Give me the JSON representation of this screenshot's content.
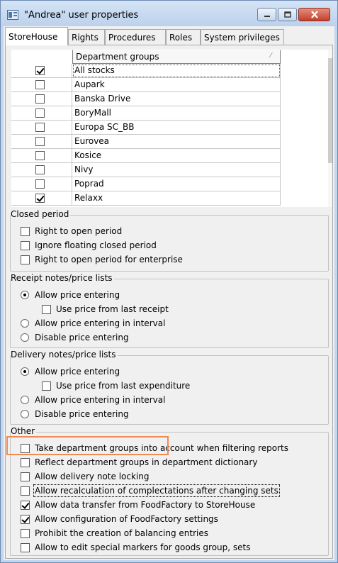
{
  "window": {
    "title": "\"Andrea\" user properties",
    "min_icon": "minimize-icon",
    "max_icon": "maximize-icon",
    "close_icon": "close-icon"
  },
  "tabs": [
    {
      "label": "StoreHouse",
      "active": true
    },
    {
      "label": "Rights",
      "active": false
    },
    {
      "label": "Procedures",
      "active": false
    },
    {
      "label": "Roles",
      "active": false
    },
    {
      "label": "System privileges",
      "active": false
    }
  ],
  "grid": {
    "header": "Department groups",
    "sort_indicator": "⁄",
    "rows": [
      {
        "name": "All stocks",
        "checked": true
      },
      {
        "name": "Aupark",
        "checked": false
      },
      {
        "name": "Banska Drive",
        "checked": false
      },
      {
        "name": "BoryMall",
        "checked": false
      },
      {
        "name": "Europa SC_BB",
        "checked": false
      },
      {
        "name": "Eurovea",
        "checked": false
      },
      {
        "name": "Kosice",
        "checked": false
      },
      {
        "name": "Nivy",
        "checked": false
      },
      {
        "name": "Poprad",
        "checked": false
      },
      {
        "name": "Relaxx",
        "checked": true
      }
    ]
  },
  "closed_period": {
    "label": "Closed period",
    "options": [
      {
        "label": "Right to open period",
        "checked": false
      },
      {
        "label": "Ignore floating closed period",
        "checked": false
      },
      {
        "label": "Right to open period for enterprise",
        "checked": false
      }
    ]
  },
  "receipt": {
    "label": "Receipt notes/price lists",
    "allow": "Allow price entering",
    "use_last": "Use price from last receipt",
    "interval": "Allow price entering in interval",
    "disable": "Disable price entering",
    "selected": "allow"
  },
  "delivery": {
    "label": "Delivery notes/price lists",
    "allow": "Allow price entering",
    "use_last": "Use price from last expenditure",
    "interval": "Allow price entering in interval",
    "disable": "Disable price entering",
    "selected": "allow"
  },
  "other": {
    "label": "Other",
    "options": [
      {
        "label": "Take department groups into account when filtering reports",
        "checked": false
      },
      {
        "label": "Reflect department groups in department dictionary",
        "checked": false
      },
      {
        "label": "Allow delivery note locking",
        "checked": false
      },
      {
        "label": "Allow recalculation of complectations after changing sets",
        "checked": false
      },
      {
        "label": "Allow data transfer from FoodFactory to StoreHouse",
        "checked": true
      },
      {
        "label": "Allow configuration of FoodFactory settings",
        "checked": true
      },
      {
        "label": "Prohibit the creation of balancing entries",
        "checked": false
      },
      {
        "label": "Allow to edit special markers for goods group, sets",
        "checked": false
      }
    ]
  },
  "colors": {
    "highlight": "#ee8a52",
    "close_button": "#c4402b",
    "title_bar": "#c3d6ee"
  }
}
